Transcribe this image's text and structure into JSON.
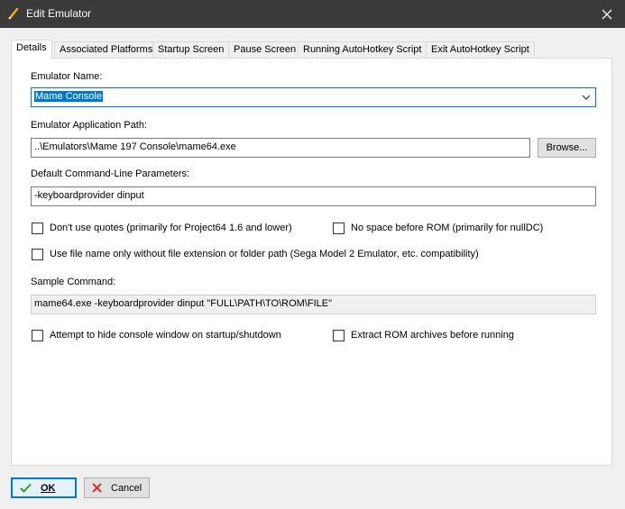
{
  "window": {
    "title": "Edit Emulator",
    "title_icon": "pencil-icon",
    "close_icon": "close-icon"
  },
  "tabs": [
    {
      "label": "Details",
      "active": true
    },
    {
      "label": "Associated Platforms"
    },
    {
      "label": "Startup Screen"
    },
    {
      "label": "Pause Screen"
    },
    {
      "label": "Running AutoHotkey Script"
    },
    {
      "label": "Exit AutoHotkey Script"
    }
  ],
  "details": {
    "emulator_name_label": "Emulator Name:",
    "emulator_name_value": "Mame Console",
    "app_path_label": "Emulator Application Path:",
    "app_path_value": "..\\Emulators\\Mame 197 Console\\mame64.exe",
    "browse_label": "Browse...",
    "cmdline_label": "Default Command-Line Parameters:",
    "cmdline_value": "-keyboardprovider dinput",
    "checkboxes": [
      {
        "label": "Don't use quotes (primarily for Project64 1.6 and lower)",
        "checked": false
      },
      {
        "label": "No space before ROM (primarily for nullDC)",
        "checked": false
      },
      {
        "label": "Use file name only without file extension or folder path (Sega Model 2 Emulator, etc. compatibility)",
        "checked": false
      },
      {
        "label": "Attempt to hide console window on startup/shutdown",
        "checked": false
      },
      {
        "label": "Extract ROM archives before running",
        "checked": false
      }
    ],
    "sample_label": "Sample Command:",
    "sample_value": "mame64.exe -keyboardprovider dinput \"FULL\\PATH\\TO\\ROM\\FILE\""
  },
  "footer": {
    "ok_label": "OK",
    "cancel_label": "Cancel",
    "ok_icon": "checkmark-icon",
    "cancel_icon": "cross-icon",
    "ok_icon_color": "#2e9e2e",
    "cancel_icon_color": "#d32f2f"
  },
  "colors": {
    "accent": "#0078d7",
    "titlebar": "#3a3a3a"
  }
}
